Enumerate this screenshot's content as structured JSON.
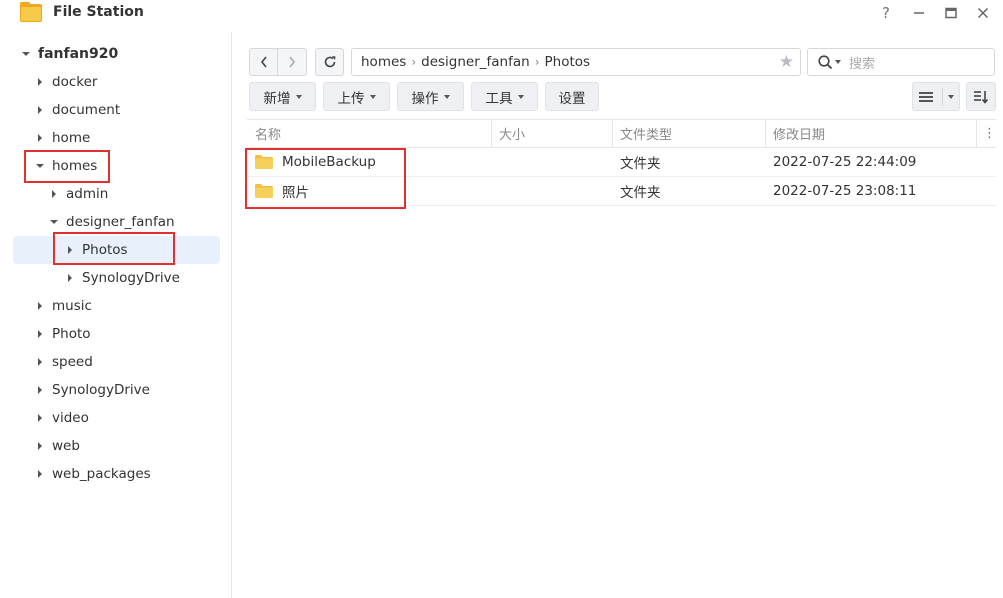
{
  "window": {
    "title": "File Station",
    "help_label": "?",
    "minimize_label": "−",
    "maximize_label": "□",
    "close_label": "✕"
  },
  "sidebar": {
    "root": "fanfan920",
    "items": [
      {
        "label": "docker",
        "expanded": false
      },
      {
        "label": "document",
        "expanded": false
      },
      {
        "label": "home",
        "expanded": false
      },
      {
        "label": "homes",
        "expanded": true
      },
      {
        "label": "admin",
        "expanded": false
      },
      {
        "label": "designer_fanfan",
        "expanded": true
      },
      {
        "label": "Photos",
        "expanded": false,
        "selected": true
      },
      {
        "label": "SynologyDrive",
        "expanded": false
      },
      {
        "label": "music",
        "expanded": false
      },
      {
        "label": "Photo",
        "expanded": false
      },
      {
        "label": "speed",
        "expanded": false
      },
      {
        "label": "SynologyDrive",
        "expanded": false
      },
      {
        "label": "video",
        "expanded": false
      },
      {
        "label": "web",
        "expanded": false
      },
      {
        "label": "web_packages",
        "expanded": false
      }
    ]
  },
  "pathbar": {
    "segments": [
      "homes",
      "designer_fanfan",
      "Photos"
    ],
    "search_placeholder": "搜索"
  },
  "toolbar": {
    "create_label": "新增",
    "upload_label": "上传",
    "action_label": "操作",
    "tools_label": "工具",
    "settings_label": "设置"
  },
  "table": {
    "columns": [
      "名称",
      "大小",
      "文件类型",
      "修改日期"
    ],
    "rows": [
      {
        "name": "MobileBackup",
        "size": "",
        "type": "文件夹",
        "modified": "2022-07-25 22:44:09"
      },
      {
        "name": "照片",
        "size": "",
        "type": "文件夹",
        "modified": "2022-07-25 23:08:11"
      }
    ]
  },
  "colors": {
    "accent_highlight": "#e03030",
    "selection_bg": "#e8f0fb",
    "folder": "#f5c342"
  }
}
